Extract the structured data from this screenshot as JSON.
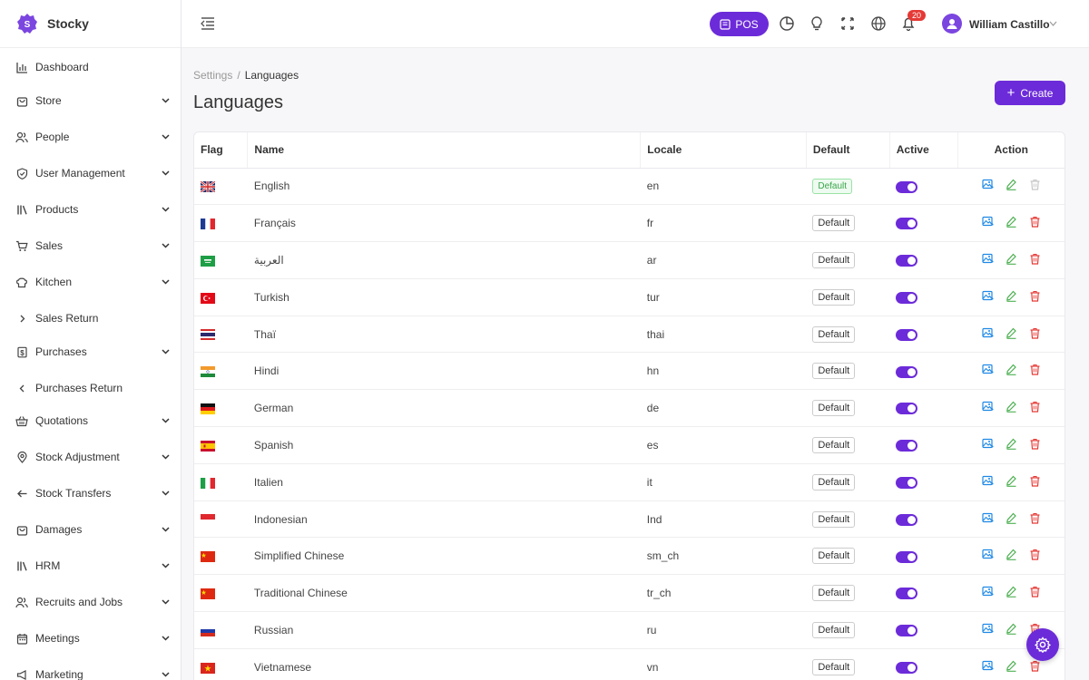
{
  "app": {
    "name": "Stocky"
  },
  "sidebar": {
    "items": [
      {
        "label": "Dashboard",
        "icon": "bar-chart-icon",
        "chevron": "none"
      },
      {
        "label": "Store",
        "icon": "store-icon",
        "chevron": "down"
      },
      {
        "label": "People",
        "icon": "users-icon",
        "chevron": "down"
      },
      {
        "label": "User Management",
        "icon": "shield-check-icon",
        "chevron": "down"
      },
      {
        "label": "Products",
        "icon": "books-icon",
        "chevron": "down"
      },
      {
        "label": "Sales",
        "icon": "cart-icon",
        "chevron": "down"
      },
      {
        "label": "Kitchen",
        "icon": "chef-hat-icon",
        "chevron": "down"
      },
      {
        "label": "Sales Return",
        "icon": "chevron-right-icon",
        "chevron": "none"
      },
      {
        "label": "Purchases",
        "icon": "receipt-icon",
        "chevron": "down"
      },
      {
        "label": "Purchases Return",
        "icon": "chevron-left-icon",
        "chevron": "none"
      },
      {
        "label": "Quotations",
        "icon": "basket-icon",
        "chevron": "down"
      },
      {
        "label": "Stock Adjustment",
        "icon": "map-pin-icon",
        "chevron": "down"
      },
      {
        "label": "Stock Transfers",
        "icon": "arrow-left-icon",
        "chevron": "down"
      },
      {
        "label": "Damages",
        "icon": "store-icon",
        "chevron": "down"
      },
      {
        "label": "HRM",
        "icon": "books-icon",
        "chevron": "down"
      },
      {
        "label": "Recruits and Jobs",
        "icon": "users-icon",
        "chevron": "down"
      },
      {
        "label": "Meetings",
        "icon": "calendar-icon",
        "chevron": "down"
      },
      {
        "label": "Marketing",
        "icon": "megaphone-icon",
        "chevron": "down"
      }
    ]
  },
  "header": {
    "pos_label": "POS",
    "notification_count": "20",
    "user_name": "William Castillo"
  },
  "breadcrumb": {
    "parent": "Settings",
    "separator": "/",
    "current": "Languages"
  },
  "page": {
    "title": "Languages",
    "create_label": "Create"
  },
  "table": {
    "columns": {
      "flag": "Flag",
      "name": "Name",
      "locale": "Locale",
      "default": "Default",
      "active": "Active",
      "action": "Action"
    },
    "rows": [
      {
        "flag": "uk",
        "name": "English",
        "locale": "en",
        "default_label": "Default",
        "is_default": true,
        "active": true
      },
      {
        "flag": "fr",
        "name": "Français",
        "locale": "fr",
        "default_label": "Default",
        "is_default": false,
        "active": true
      },
      {
        "flag": "sa",
        "name": "العربية",
        "locale": "ar",
        "default_label": "Default",
        "is_default": false,
        "active": true
      },
      {
        "flag": "tr",
        "name": "Turkish",
        "locale": "tur",
        "default_label": "Default",
        "is_default": false,
        "active": true
      },
      {
        "flag": "th",
        "name": "Thaï",
        "locale": "thai",
        "default_label": "Default",
        "is_default": false,
        "active": true
      },
      {
        "flag": "in",
        "name": "Hindi",
        "locale": "hn",
        "default_label": "Default",
        "is_default": false,
        "active": true
      },
      {
        "flag": "de",
        "name": "German",
        "locale": "de",
        "default_label": "Default",
        "is_default": false,
        "active": true
      },
      {
        "flag": "es",
        "name": "Spanish",
        "locale": "es",
        "default_label": "Default",
        "is_default": false,
        "active": true
      },
      {
        "flag": "it",
        "name": "Italien",
        "locale": "it",
        "default_label": "Default",
        "is_default": false,
        "active": true
      },
      {
        "flag": "id",
        "name": "Indonesian",
        "locale": "Ind",
        "default_label": "Default",
        "is_default": false,
        "active": true
      },
      {
        "flag": "cn",
        "name": "Simplified Chinese",
        "locale": "sm_ch",
        "default_label": "Default",
        "is_default": false,
        "active": true
      },
      {
        "flag": "cn",
        "name": "Traditional Chinese",
        "locale": "tr_ch",
        "default_label": "Default",
        "is_default": false,
        "active": true
      },
      {
        "flag": "ru",
        "name": "Russian",
        "locale": "ru",
        "default_label": "Default",
        "is_default": false,
        "active": true
      },
      {
        "flag": "vn",
        "name": "Vietnamese",
        "locale": "vn",
        "default_label": "Default",
        "is_default": false,
        "active": true
      }
    ]
  },
  "colors": {
    "accent": "#6c2bd9",
    "edit": "#4caf50",
    "delete": "#e53935",
    "image": "#1e88e5"
  }
}
